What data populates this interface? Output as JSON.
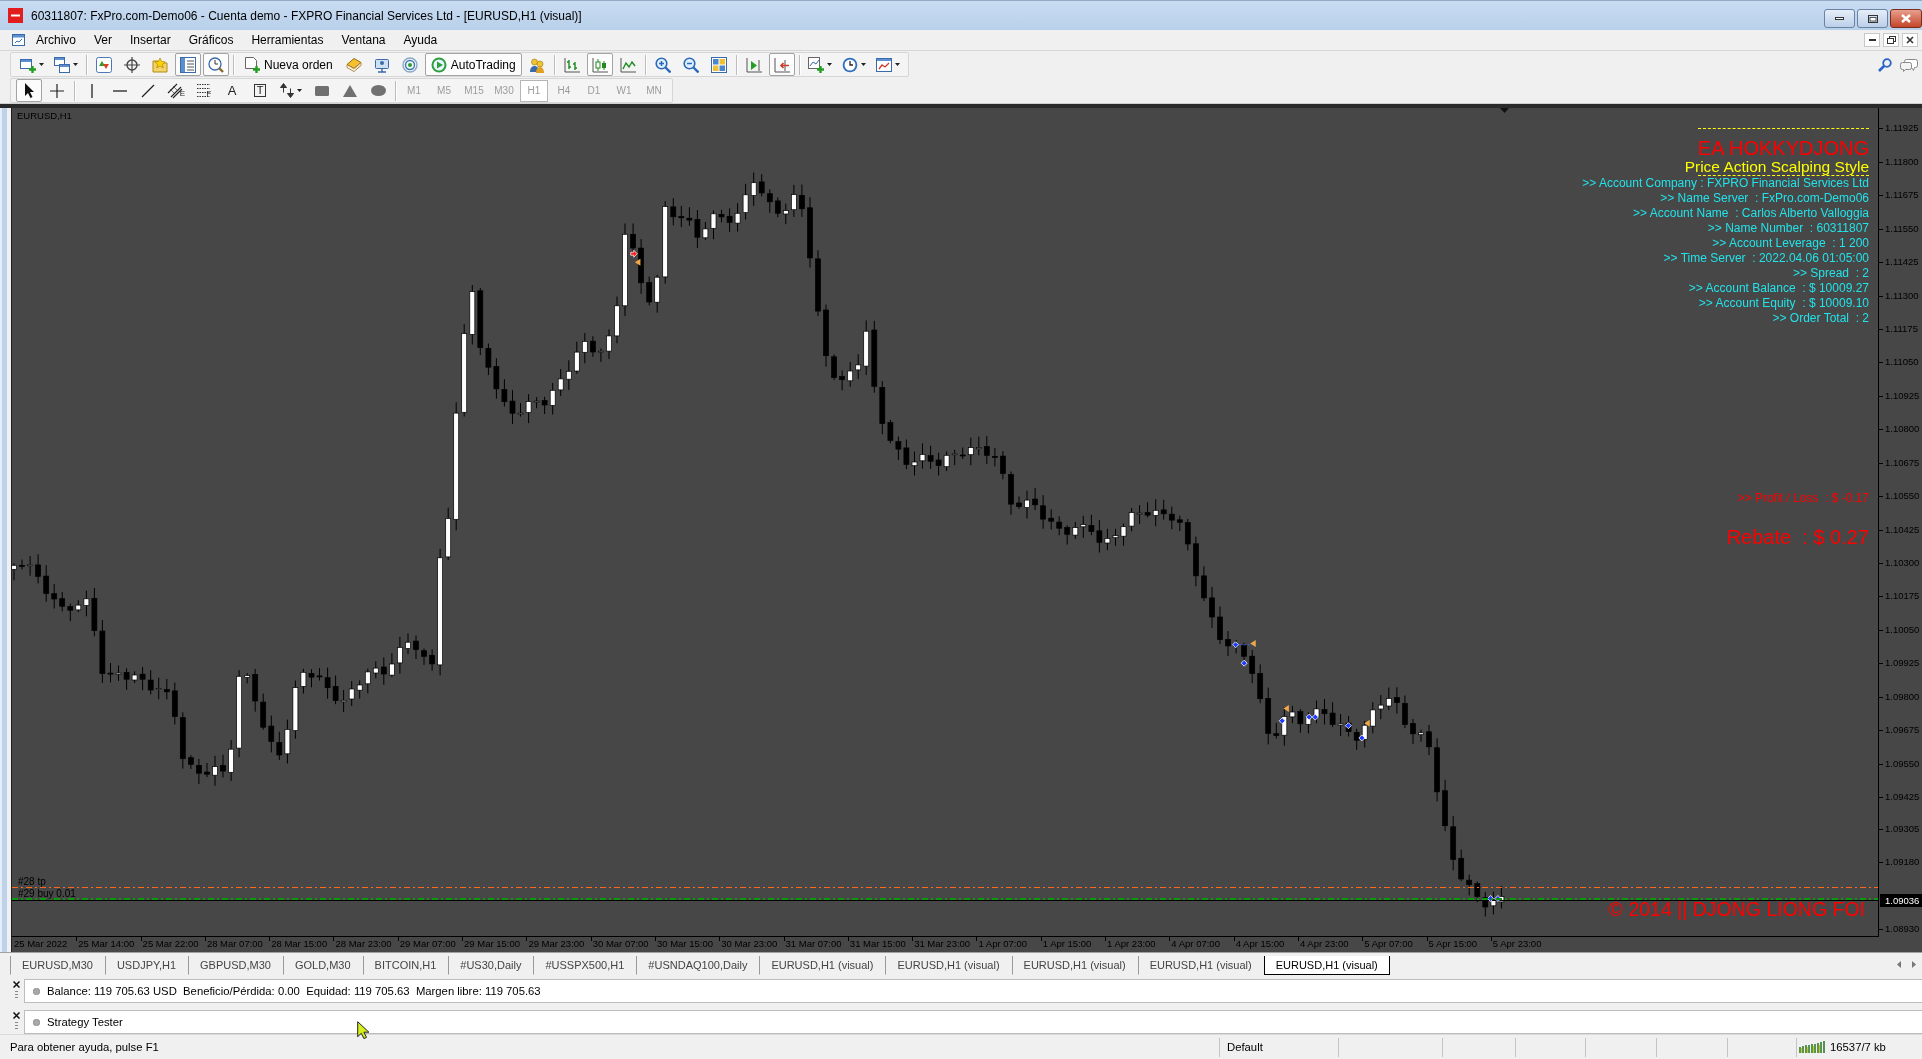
{
  "window": {
    "title": "60311807: FxPro.com-Demo06 - Cuenta demo - FXPRO Financial Services Ltd - [EURUSD,H1 (visual)]"
  },
  "menu": [
    "Archivo",
    "Ver",
    "Insertar",
    "Gráficos",
    "Herramientas",
    "Ventana",
    "Ayuda"
  ],
  "main_toolbar": [
    [
      {
        "kind": "dropdown",
        "pressed": false
      },
      {
        "kind": "dropdown",
        "pressed": false
      }
    ],
    [
      {
        "kind": "icon",
        "pressed": false
      },
      {
        "kind": "icon",
        "pressed": false
      },
      {
        "kind": "icon",
        "pressed": false
      },
      {
        "kind": "icon",
        "pressed": true
      },
      {
        "kind": "icon",
        "pressed": true
      }
    ],
    [
      {
        "kind": "button",
        "label": "Nueva orden",
        "pressed": false
      },
      {
        "kind": "icon",
        "pressed": false
      },
      {
        "kind": "icon",
        "pressed": false
      },
      {
        "kind": "icon",
        "pressed": false
      },
      {
        "kind": "button",
        "label": "AutoTrading",
        "pressed": true
      },
      {
        "kind": "icon",
        "pressed": false
      }
    ],
    [
      {
        "kind": "icon",
        "pressed": false
      },
      {
        "kind": "icon",
        "pressed": true
      },
      {
        "kind": "icon",
        "pressed": false
      }
    ],
    [
      {
        "kind": "icon",
        "pressed": false
      },
      {
        "kind": "icon",
        "pressed": false
      },
      {
        "kind": "icon",
        "pressed": false
      }
    ],
    [
      {
        "kind": "icon",
        "pressed": false
      },
      {
        "kind": "icon",
        "pressed": true
      }
    ],
    [
      {
        "kind": "dropdown",
        "pressed": false
      },
      {
        "kind": "dropdown",
        "pressed": false
      },
      {
        "kind": "dropdown",
        "pressed": false
      }
    ]
  ],
  "drawing_toolbar": [
    [
      {
        "kind": "icon",
        "pressed": true
      },
      {
        "kind": "icon",
        "pressed": false
      }
    ],
    [
      {
        "kind": "icon",
        "pressed": false
      },
      {
        "kind": "icon",
        "pressed": false
      },
      {
        "kind": "icon",
        "pressed": false
      },
      {
        "kind": "tagged",
        "label": "E",
        "pressed": false
      },
      {
        "kind": "tagged",
        "label": "F",
        "pressed": false
      },
      {
        "kind": "glyph",
        "label": "A",
        "pressed": false
      },
      {
        "kind": "boxed",
        "label": "T",
        "pressed": false
      },
      {
        "kind": "dropdown",
        "pressed": false
      },
      {
        "kind": "icon",
        "pressed": false
      },
      {
        "kind": "icon",
        "pressed": false
      },
      {
        "kind": "icon",
        "pressed": false
      }
    ]
  ],
  "timeframes": [
    {
      "label": "M1",
      "selected": false,
      "disabled": true
    },
    {
      "label": "M5",
      "selected": false,
      "disabled": true
    },
    {
      "label": "M15",
      "selected": false,
      "disabled": true
    },
    {
      "label": "M30",
      "selected": false,
      "disabled": true
    },
    {
      "label": "H1",
      "selected": true,
      "disabled": true
    },
    {
      "label": "H4",
      "selected": false,
      "disabled": true
    },
    {
      "label": "D1",
      "selected": false,
      "disabled": true
    },
    {
      "label": "W1",
      "selected": false,
      "disabled": true
    },
    {
      "label": "MN",
      "selected": false,
      "disabled": true
    }
  ],
  "chart": {
    "symbol": "EURUSD,H1",
    "price_axis": [
      "1.11925",
      "1.11800",
      "1.11675",
      "1.11550",
      "1.11425",
      "1.11300",
      "1.11175",
      "1.11050",
      "1.10925",
      "1.10800",
      "1.10675",
      "1.10550",
      "1.10425",
      "1.10300",
      "1.10175",
      "1.10050",
      "1.09925",
      "1.09800",
      "1.09675",
      "1.09550",
      "1.09425",
      "1.09305",
      "1.09180",
      "1.08930"
    ],
    "current_price": "1.09036",
    "time_axis": [
      "25 Mar 2022",
      "25 Mar 14:00",
      "25 Mar 22:00",
      "28 Mar 07:00",
      "28 Mar 15:00",
      "28 Mar 23:00",
      "29 Mar 07:00",
      "29 Mar 15:00",
      "29 Mar 23:00",
      "30 Mar 07:00",
      "30 Mar 15:00",
      "30 Mar 23:00",
      "31 Mar 07:00",
      "31 Mar 15:00",
      "31 Mar 23:00",
      "1 Apr 07:00",
      "1 Apr 15:00",
      "1 Apr 23:00",
      "4 Apr 07:00",
      "4 Apr 15:00",
      "4 Apr 23:00",
      "5 Apr 07:00",
      "5 Apr 15:00",
      "5 Apr 23:00"
    ],
    "order_lines": [
      {
        "label": "#28 tp",
        "kind": "take-profit"
      },
      {
        "label": "#29 buy 0.01",
        "kind": "entry"
      }
    ],
    "expert_panel": [
      {
        "kind": "divider"
      },
      {
        "kind": "title",
        "text": "EA HOKKYDJONG"
      },
      {
        "kind": "subtitle",
        "text": "Price Action Scalping Style"
      },
      {
        "kind": "divider"
      },
      {
        "kind": "info",
        "text": ">> Account Company : FXPRO Financial Services Ltd"
      },
      {
        "kind": "info",
        "text": ">> Name Server  : FxPro.com-Demo06"
      },
      {
        "kind": "info",
        "text": ">> Account Name  : Carlos Alberto Valloggia"
      },
      {
        "kind": "info",
        "text": ">> Name Number  : 60311807"
      },
      {
        "kind": "info",
        "text": ">> Account Leverage  : 1 200"
      },
      {
        "kind": "info",
        "text": ">> Time Server  : 2022.04.06 01:05:00"
      },
      {
        "kind": "info",
        "text": ">> Spread  : 2"
      },
      {
        "kind": "info",
        "text": ">> Account Balance  : $ 10009.27"
      },
      {
        "kind": "info",
        "text": ">> Account Equity  : $ 10009.10"
      },
      {
        "kind": "info",
        "text": ">> Order Total  : 2"
      },
      {
        "kind": "profit",
        "text": ">> Profit / Loss  : $ -0.17"
      },
      {
        "kind": "rebate",
        "text": "Rebate  : $ 0.27"
      }
    ],
    "copyright": "© 2014 || DJONG LIONG FOI"
  },
  "chart_tabs": [
    {
      "label": "EURUSD,M30",
      "selected": false
    },
    {
      "label": "USDJPY,H1",
      "selected": false
    },
    {
      "label": "GBPUSD,M30",
      "selected": false
    },
    {
      "label": "GOLD,M30",
      "selected": false
    },
    {
      "label": "BITCOIN,H1",
      "selected": false
    },
    {
      "label": "#US30,Daily",
      "selected": false
    },
    {
      "label": "#USSPX500,H1",
      "selected": false
    },
    {
      "label": "#USNDAQ100,Daily",
      "selected": false
    },
    {
      "label": "EURUSD,H1 (visual)",
      "selected": false
    },
    {
      "label": "EURUSD,H1 (visual)",
      "selected": false
    },
    {
      "label": "EURUSD,H1 (visual)",
      "selected": false
    },
    {
      "label": "EURUSD,H1 (visual)",
      "selected": false
    },
    {
      "label": "EURUSD,H1 (visual)",
      "selected": true
    }
  ],
  "account_bar": {
    "text": "Balance: 119 705.63 USD  Beneficio/Pérdida: 0.00  Equidad: 119 705.63  Margen libre: 119 705.63"
  },
  "tester_bar": {
    "title": "Strategy Tester"
  },
  "status_bar": {
    "help": "Para obtener ayuda, pulse F1",
    "profile": "Default",
    "traffic": "16537/7 kb"
  }
}
